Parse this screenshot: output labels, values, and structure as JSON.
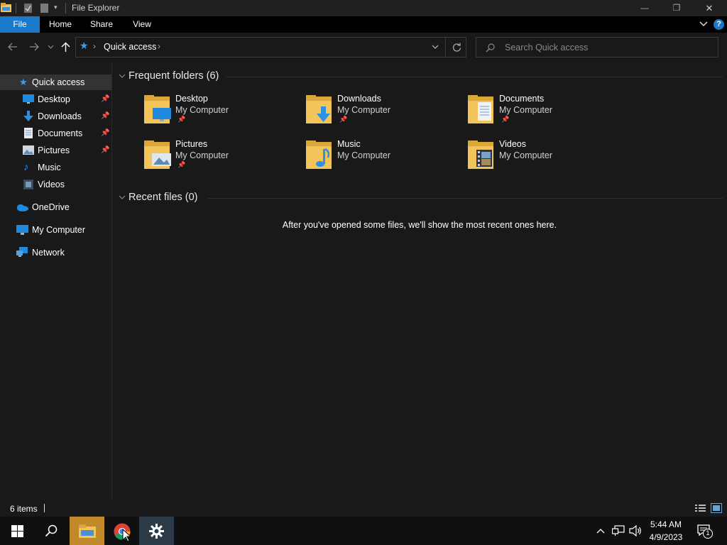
{
  "window": {
    "title": "File Explorer",
    "controls": {
      "minimize": "—",
      "maximize": "❐",
      "close": "✕"
    }
  },
  "ribbon": {
    "tabs": [
      {
        "label": "File",
        "active": true
      },
      {
        "label": "Home"
      },
      {
        "label": "Share"
      },
      {
        "label": "View"
      }
    ],
    "help": "?"
  },
  "address": {
    "path": [
      "Quick access"
    ],
    "separator": "›"
  },
  "search": {
    "placeholder": "Search Quick access"
  },
  "nav": {
    "quick_access": "Quick access",
    "items": [
      {
        "label": "Desktop",
        "pinned": true
      },
      {
        "label": "Downloads",
        "pinned": true
      },
      {
        "label": "Documents",
        "pinned": true
      },
      {
        "label": "Pictures",
        "pinned": true
      },
      {
        "label": "Music"
      },
      {
        "label": "Videos"
      }
    ],
    "onedrive": "OneDrive",
    "computer": "My Computer",
    "network": "Network"
  },
  "frequent": {
    "heading": "Frequent folders (6)",
    "folders": [
      {
        "name": "Desktop",
        "location": "My Computer",
        "pinned": true
      },
      {
        "name": "Downloads",
        "location": "My Computer",
        "pinned": true
      },
      {
        "name": "Documents",
        "location": "My Computer",
        "pinned": true
      },
      {
        "name": "Pictures",
        "location": "My Computer",
        "pinned": true
      },
      {
        "name": "Music",
        "location": "My Computer"
      },
      {
        "name": "Videos",
        "location": "My Computer"
      }
    ]
  },
  "recent": {
    "heading": "Recent files (0)",
    "empty_message": "After you've opened some files, we'll show the most recent ones here."
  },
  "status": {
    "items": "6 items"
  },
  "taskbar": {
    "time": "5:44 AM",
    "date": "4/9/2023",
    "notifications": "1"
  },
  "colors": {
    "accent": "#0078d7",
    "folder": "#f3c45a",
    "active_taskbar": "#c08a2a",
    "selected_nav": "#333333"
  }
}
